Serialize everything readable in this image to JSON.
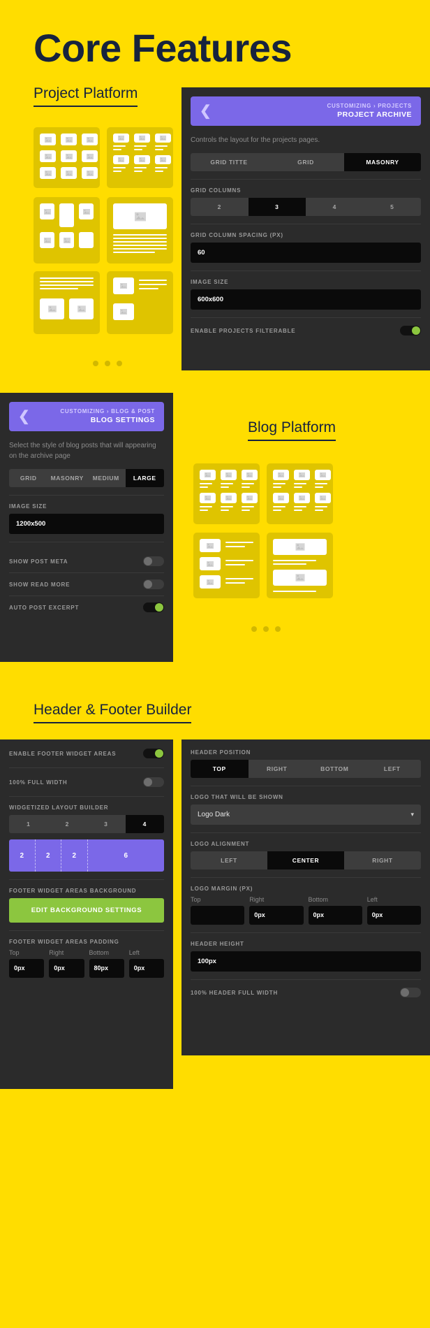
{
  "page": {
    "title": "Core Features",
    "bg_color": "#FFDD00",
    "heading_color": "#17233d"
  },
  "sections": {
    "project_platform": "Project Platform",
    "blog_platform": "Blog Platform",
    "header_footer": "Header & Footer Builder"
  },
  "projects_panel": {
    "back_icon": "chevron-left-icon",
    "breadcrumb": "CUSTOMIZING › PROJECTS",
    "name": "PROJECT ARCHIVE",
    "description": "Controls the layout for the projects pages.",
    "style_tabs": [
      {
        "label": "GRID TITTE",
        "active": false
      },
      {
        "label": "GRID",
        "active": false
      },
      {
        "label": "MASONRY",
        "active": true
      }
    ],
    "grid_columns_label": "GRID COLUMNS",
    "grid_columns": [
      {
        "label": "2",
        "active": false
      },
      {
        "label": "3",
        "active": true
      },
      {
        "label": "4",
        "active": false
      },
      {
        "label": "5",
        "active": false
      }
    ],
    "spacing_label": "GRID COLUMN SPACING (PX)",
    "spacing_value": "60",
    "image_size_label": "IMAGE SIZE",
    "image_size_value": "600x600",
    "filterable_label": "ENABLE PROJECTS FILTERABLE",
    "filterable_on": true
  },
  "blog_panel": {
    "back_icon": "chevron-left-icon",
    "breadcrumb": "CUSTOMIZING › BLOG & POST",
    "name": "BLOG SETTINGS",
    "description": "Select the style of blog posts that will appearing on the archive page",
    "style_tabs": [
      {
        "label": "GRID",
        "active": false
      },
      {
        "label": "MASONRY",
        "active": false
      },
      {
        "label": "MEDIUM",
        "active": false
      },
      {
        "label": "LARGE",
        "active": true
      }
    ],
    "image_size_label": "IMAGE SIZE",
    "image_size_value": "1200x500",
    "toggles": [
      {
        "label": "SHOW POST META",
        "on": false
      },
      {
        "label": "SHOW READ MORE",
        "on": false
      },
      {
        "label": "AUTO POST EXCERPT",
        "on": true
      }
    ]
  },
  "footer_panel": {
    "enable_widget_label": "ENABLE FOOTER WIDGET AREAS",
    "enable_widget_on": true,
    "full_width_label": "100% FULL WIDTH",
    "full_width_on": false,
    "builder_label": "WIDGETIZED LAYOUT BUILDER",
    "builder_counts": [
      {
        "label": "1",
        "active": false
      },
      {
        "label": "2",
        "active": false
      },
      {
        "label": "3",
        "active": false
      },
      {
        "label": "4",
        "active": true
      }
    ],
    "layout_cells": [
      {
        "label": "2",
        "span": 2
      },
      {
        "label": "2",
        "span": 2
      },
      {
        "label": "2",
        "span": 2
      },
      {
        "label": "6",
        "span": 6
      }
    ],
    "background_label": "FOOTER WIDGET AREAS BACKGROUND",
    "background_button": "EDIT BACKGROUND SETTINGS",
    "padding_label": "FOOTER WIDGET AREAS PADDING",
    "padding": [
      {
        "cap": "Top",
        "value": "0px"
      },
      {
        "cap": "Right",
        "value": "0px"
      },
      {
        "cap": "Bottom",
        "value": "80px"
      },
      {
        "cap": "Left",
        "value": "0px"
      }
    ]
  },
  "header_panel": {
    "position_label": "HEADER POSITION",
    "positions": [
      {
        "label": "TOP",
        "active": true
      },
      {
        "label": "RIGHT",
        "active": false
      },
      {
        "label": "BOTTOM",
        "active": false
      },
      {
        "label": "LEFT",
        "active": false
      }
    ],
    "logo_label": "LOGO THAT WILL BE SHOWN",
    "logo_value": "Logo Dark",
    "logo_chevron": "chevron-down-icon",
    "alignment_label": "LOGO ALIGNMENT",
    "alignments": [
      {
        "label": "LEFT",
        "active": false
      },
      {
        "label": "CENTER",
        "active": true
      },
      {
        "label": "RIGHT",
        "active": false
      }
    ],
    "margin_label": "LOGO MARGIN (PX)",
    "margin": [
      {
        "cap": "Top",
        "value": ""
      },
      {
        "cap": "Right",
        "value": "0px"
      },
      {
        "cap": "Bottom",
        "value": "0px"
      },
      {
        "cap": "Left",
        "value": "0px"
      }
    ],
    "height_label": "HEADER HEIGHT",
    "height_value": "100px",
    "full_width_label": "100% HEADER FULL WIDTH",
    "full_width_on": false
  },
  "colors": {
    "accent_purple": "#7B68E8",
    "accent_green": "#8CC63F",
    "panel_bg": "#2b2b2b",
    "card_yellow": "#DFC400"
  }
}
